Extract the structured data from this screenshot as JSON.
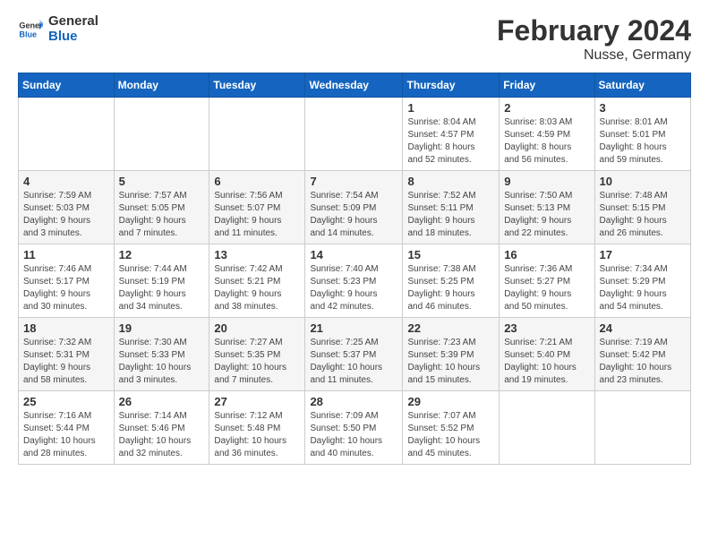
{
  "header": {
    "logo_general": "General",
    "logo_blue": "Blue",
    "title": "February 2024",
    "subtitle": "Nusse, Germany"
  },
  "calendar": {
    "days_of_week": [
      "Sunday",
      "Monday",
      "Tuesday",
      "Wednesday",
      "Thursday",
      "Friday",
      "Saturday"
    ],
    "weeks": [
      [
        {
          "day": "",
          "info": ""
        },
        {
          "day": "",
          "info": ""
        },
        {
          "day": "",
          "info": ""
        },
        {
          "day": "",
          "info": ""
        },
        {
          "day": "1",
          "info": "Sunrise: 8:04 AM\nSunset: 4:57 PM\nDaylight: 8 hours\nand 52 minutes."
        },
        {
          "day": "2",
          "info": "Sunrise: 8:03 AM\nSunset: 4:59 PM\nDaylight: 8 hours\nand 56 minutes."
        },
        {
          "day": "3",
          "info": "Sunrise: 8:01 AM\nSunset: 5:01 PM\nDaylight: 8 hours\nand 59 minutes."
        }
      ],
      [
        {
          "day": "4",
          "info": "Sunrise: 7:59 AM\nSunset: 5:03 PM\nDaylight: 9 hours\nand 3 minutes."
        },
        {
          "day": "5",
          "info": "Sunrise: 7:57 AM\nSunset: 5:05 PM\nDaylight: 9 hours\nand 7 minutes."
        },
        {
          "day": "6",
          "info": "Sunrise: 7:56 AM\nSunset: 5:07 PM\nDaylight: 9 hours\nand 11 minutes."
        },
        {
          "day": "7",
          "info": "Sunrise: 7:54 AM\nSunset: 5:09 PM\nDaylight: 9 hours\nand 14 minutes."
        },
        {
          "day": "8",
          "info": "Sunrise: 7:52 AM\nSunset: 5:11 PM\nDaylight: 9 hours\nand 18 minutes."
        },
        {
          "day": "9",
          "info": "Sunrise: 7:50 AM\nSunset: 5:13 PM\nDaylight: 9 hours\nand 22 minutes."
        },
        {
          "day": "10",
          "info": "Sunrise: 7:48 AM\nSunset: 5:15 PM\nDaylight: 9 hours\nand 26 minutes."
        }
      ],
      [
        {
          "day": "11",
          "info": "Sunrise: 7:46 AM\nSunset: 5:17 PM\nDaylight: 9 hours\nand 30 minutes."
        },
        {
          "day": "12",
          "info": "Sunrise: 7:44 AM\nSunset: 5:19 PM\nDaylight: 9 hours\nand 34 minutes."
        },
        {
          "day": "13",
          "info": "Sunrise: 7:42 AM\nSunset: 5:21 PM\nDaylight: 9 hours\nand 38 minutes."
        },
        {
          "day": "14",
          "info": "Sunrise: 7:40 AM\nSunset: 5:23 PM\nDaylight: 9 hours\nand 42 minutes."
        },
        {
          "day": "15",
          "info": "Sunrise: 7:38 AM\nSunset: 5:25 PM\nDaylight: 9 hours\nand 46 minutes."
        },
        {
          "day": "16",
          "info": "Sunrise: 7:36 AM\nSunset: 5:27 PM\nDaylight: 9 hours\nand 50 minutes."
        },
        {
          "day": "17",
          "info": "Sunrise: 7:34 AM\nSunset: 5:29 PM\nDaylight: 9 hours\nand 54 minutes."
        }
      ],
      [
        {
          "day": "18",
          "info": "Sunrise: 7:32 AM\nSunset: 5:31 PM\nDaylight: 9 hours\nand 58 minutes."
        },
        {
          "day": "19",
          "info": "Sunrise: 7:30 AM\nSunset: 5:33 PM\nDaylight: 10 hours\nand 3 minutes."
        },
        {
          "day": "20",
          "info": "Sunrise: 7:27 AM\nSunset: 5:35 PM\nDaylight: 10 hours\nand 7 minutes."
        },
        {
          "day": "21",
          "info": "Sunrise: 7:25 AM\nSunset: 5:37 PM\nDaylight: 10 hours\nand 11 minutes."
        },
        {
          "day": "22",
          "info": "Sunrise: 7:23 AM\nSunset: 5:39 PM\nDaylight: 10 hours\nand 15 minutes."
        },
        {
          "day": "23",
          "info": "Sunrise: 7:21 AM\nSunset: 5:40 PM\nDaylight: 10 hours\nand 19 minutes."
        },
        {
          "day": "24",
          "info": "Sunrise: 7:19 AM\nSunset: 5:42 PM\nDaylight: 10 hours\nand 23 minutes."
        }
      ],
      [
        {
          "day": "25",
          "info": "Sunrise: 7:16 AM\nSunset: 5:44 PM\nDaylight: 10 hours\nand 28 minutes."
        },
        {
          "day": "26",
          "info": "Sunrise: 7:14 AM\nSunset: 5:46 PM\nDaylight: 10 hours\nand 32 minutes."
        },
        {
          "day": "27",
          "info": "Sunrise: 7:12 AM\nSunset: 5:48 PM\nDaylight: 10 hours\nand 36 minutes."
        },
        {
          "day": "28",
          "info": "Sunrise: 7:09 AM\nSunset: 5:50 PM\nDaylight: 10 hours\nand 40 minutes."
        },
        {
          "day": "29",
          "info": "Sunrise: 7:07 AM\nSunset: 5:52 PM\nDaylight: 10 hours\nand 45 minutes."
        },
        {
          "day": "",
          "info": ""
        },
        {
          "day": "",
          "info": ""
        }
      ]
    ]
  }
}
